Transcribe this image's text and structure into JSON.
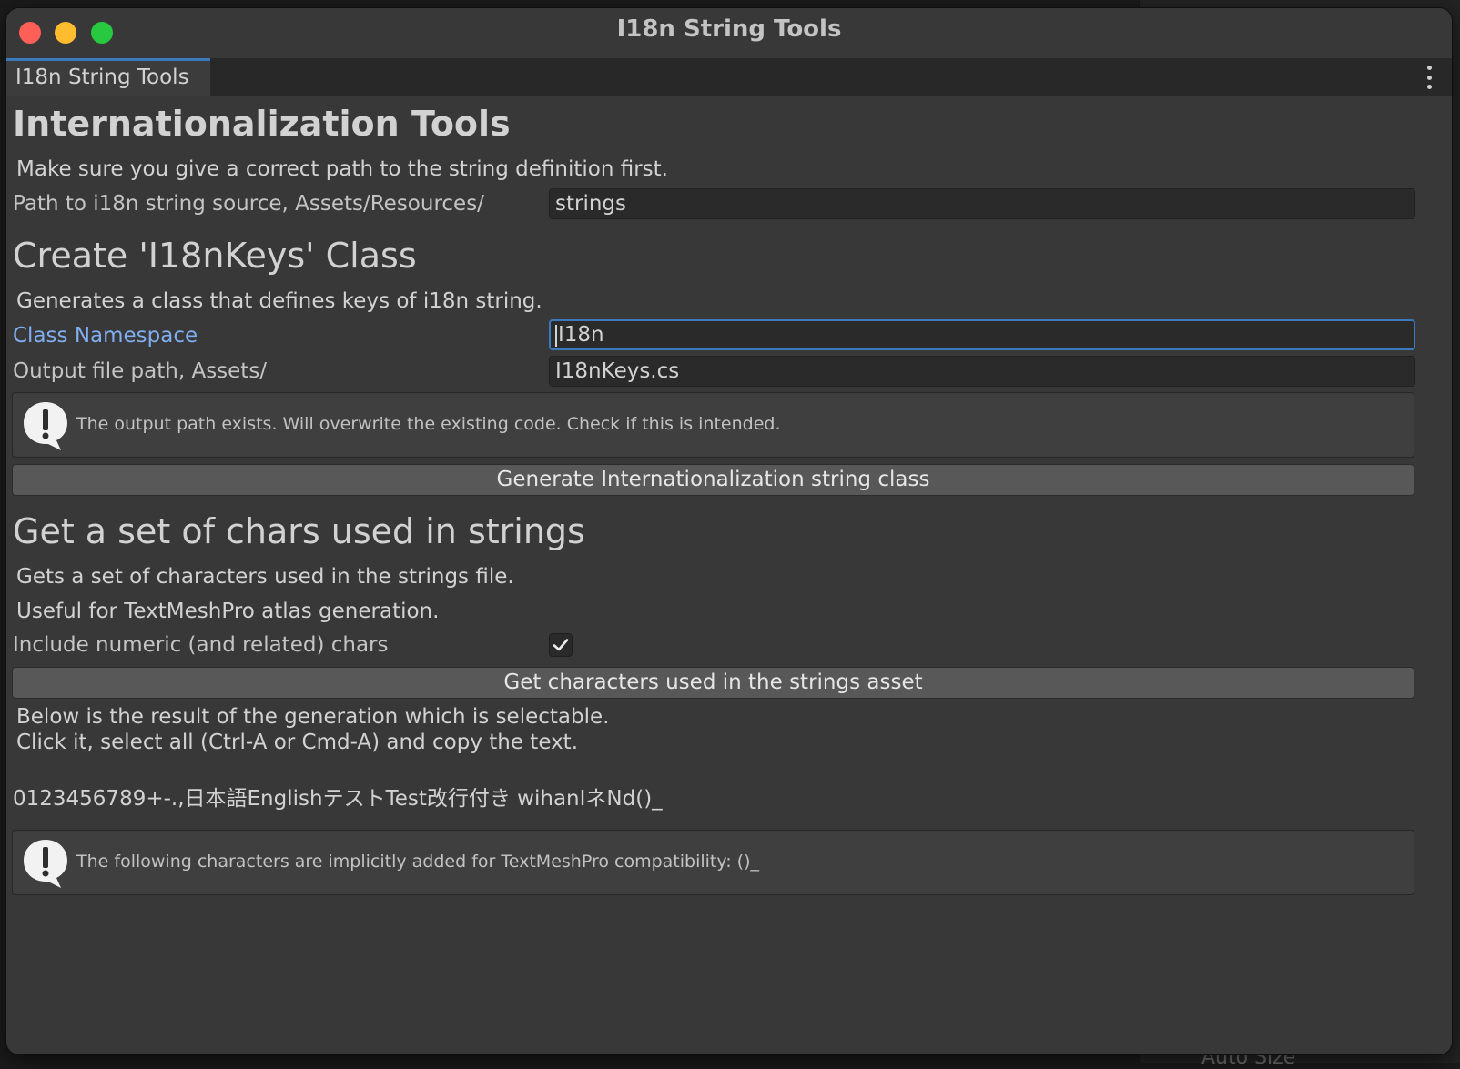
{
  "window": {
    "title": "I18n String Tools"
  },
  "tab": {
    "label": "I18n String Tools"
  },
  "main_heading": "Internationalization Tools",
  "intro": "Make sure you give a correct path to the string definition first.",
  "source_path": {
    "label": "Path to i18n string source, Assets/Resources/",
    "value": "strings"
  },
  "create_class": {
    "heading": "Create 'I18nKeys' Class",
    "description": "Generates a class that defines keys of i18n string.",
    "namespace": {
      "label": "Class Namespace",
      "value": "I18n"
    },
    "output_path": {
      "label": "Output file path, Assets/",
      "value": "I18nKeys.cs"
    },
    "warning": "The output path exists. Will overwrite the existing code. Check if this is intended.",
    "generate_button": "Generate Internationalization string class"
  },
  "chars_section": {
    "heading": "Get a set of chars used in strings",
    "description_line1": "Gets a set of characters used in the strings file.",
    "description_line2": "Useful for TextMeshPro atlas generation.",
    "include_numeric": {
      "label": "Include numeric (and related) chars",
      "checked": true
    },
    "get_button": "Get characters used in the strings asset",
    "result_note_line1": "Below is the result of the generation which is selectable.",
    "result_note_line2": "Click it, select all (Ctrl-A or Cmd-A) and copy the text.",
    "result_text": "0123456789+-.,日本語EnglishテストTest改行付き wihanIネNd()_",
    "info": "The following characters are implicitly added for TextMeshPro compatibility: ()_"
  },
  "background_fragment": "Auto Size",
  "colors": {
    "window_bg": "#383838",
    "accent": "#3a79bb",
    "focus_label": "#80aef0",
    "button_bg": "#585858"
  },
  "icons": [
    "close-icon",
    "minimize-icon",
    "zoom-icon",
    "more-vertical-icon",
    "warning-bubble-icon",
    "info-bubble-icon",
    "checkmark-icon"
  ]
}
